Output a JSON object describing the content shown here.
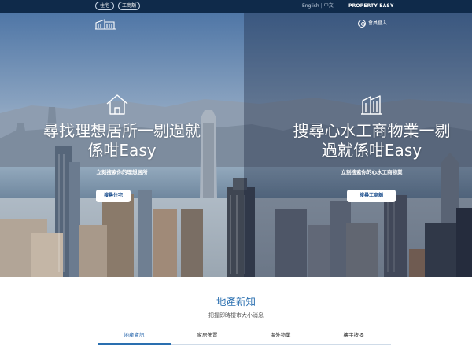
{
  "topbar": {
    "residential_label": "住宅",
    "commercial_label": "工商舖",
    "lang_english": "English",
    "lang_separator": "|",
    "lang_chinese": "中文",
    "brand": "PROPERTY EASY"
  },
  "header": {
    "login_label": "會員登入"
  },
  "hero": {
    "left": {
      "title_line1": "尋找理想居所一剔過就",
      "title_line2": "係咁Easy",
      "subtitle": "立刻搜索你的理想居所",
      "button_label": "搜尋住宅"
    },
    "right": {
      "title_line1": "搜尋心水工商物業一剔",
      "title_line2": "過就係咁Easy",
      "subtitle": "立刻搜索你的心水工商物業",
      "button_label": "搜尋工商舖"
    }
  },
  "news": {
    "title": "地產新知",
    "subtitle": "把握即時樓市大小消息",
    "tabs": [
      {
        "label": "地產資訊",
        "active": true
      },
      {
        "label": "家居佈置",
        "active": false
      },
      {
        "label": "海外物業",
        "active": false
      },
      {
        "label": "樓宇按揭",
        "active": false
      }
    ]
  },
  "colors": {
    "topbar_bg": "#0f2a4a",
    "accent": "#2a6fb0",
    "button_text": "#1c4f8e"
  }
}
